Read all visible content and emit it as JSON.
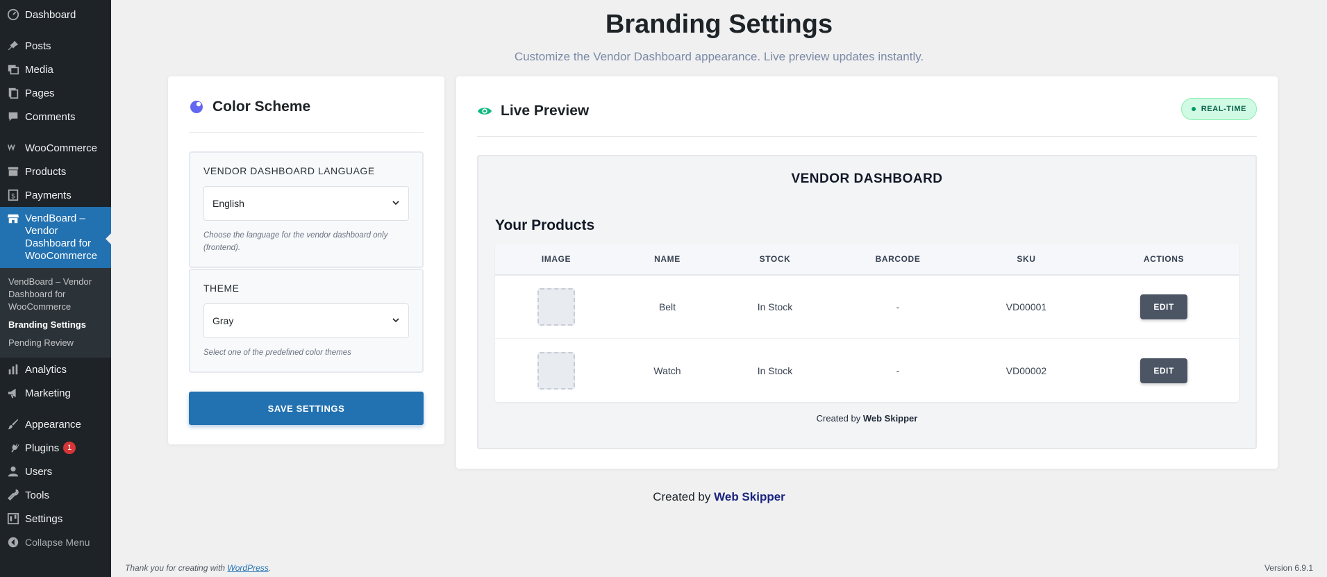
{
  "sidebar": {
    "items": [
      {
        "label": "Dashboard",
        "icon": "dashboard-icon"
      },
      {
        "label": "Posts",
        "icon": "pin-icon"
      },
      {
        "label": "Media",
        "icon": "media-icon"
      },
      {
        "label": "Pages",
        "icon": "pages-icon"
      },
      {
        "label": "Comments",
        "icon": "comment-icon"
      },
      {
        "label": "WooCommerce",
        "icon": "woo-icon"
      },
      {
        "label": "Products",
        "icon": "archive-icon"
      },
      {
        "label": "Payments",
        "icon": "dollar-icon"
      },
      {
        "label": "VendBoard – Vendor Dashboard for WooCommerce",
        "icon": "store-icon"
      },
      {
        "label": "Analytics",
        "icon": "bar-chart-icon"
      },
      {
        "label": "Marketing",
        "icon": "megaphone-icon"
      },
      {
        "label": "Appearance",
        "icon": "brush-icon"
      },
      {
        "label": "Plugins",
        "icon": "plug-icon",
        "badge": "1"
      },
      {
        "label": "Users",
        "icon": "user-icon"
      },
      {
        "label": "Tools",
        "icon": "wrench-icon"
      },
      {
        "label": "Settings",
        "icon": "sliders-icon"
      }
    ],
    "submenu": [
      "VendBoard – Vendor Dashboard for WooCommerce",
      "Branding Settings",
      "Pending Review"
    ],
    "collapse_label": "Collapse Menu"
  },
  "header": {
    "title": "Branding Settings",
    "subtitle": "Customize the Vendor Dashboard appearance. Live preview updates instantly."
  },
  "color_scheme": {
    "title": "Color Scheme",
    "language": {
      "label": "Vendor Dashboard Language",
      "value": "English",
      "help": "Choose the language for the vendor dashboard only (frontend)."
    },
    "theme": {
      "label": "Theme",
      "value": "Gray",
      "help": "Select one of the predefined color themes"
    },
    "save_label": "SAVE SETTINGS"
  },
  "preview": {
    "title": "Live Preview",
    "badge": "REAL-TIME",
    "dashboard_title": "VENDOR DASHBOARD",
    "products_title": "Your Products",
    "columns": [
      "IMAGE",
      "NAME",
      "STOCK",
      "BARCODE",
      "SKU",
      "ACTIONS"
    ],
    "rows": [
      {
        "name": "Belt",
        "stock": "In Stock",
        "barcode": "-",
        "sku": "VD00001",
        "action": "EDIT"
      },
      {
        "name": "Watch",
        "stock": "In Stock",
        "barcode": "-",
        "sku": "VD00002",
        "action": "EDIT"
      }
    ],
    "footer_prefix": "Created by",
    "footer_brand": "Web Skipper"
  },
  "credit": {
    "prefix": "Created by",
    "brand": "Web Skipper"
  },
  "wp_footer": {
    "text": "Thank you for creating with",
    "link": "WordPress",
    "suffix": ".",
    "version": "Version 6.9.1"
  },
  "colors": {
    "accent": "#2271b1",
    "sidebar_bg": "#1d2327",
    "edit_button": "#4b5563",
    "realtime_bg": "#d1fae5"
  }
}
